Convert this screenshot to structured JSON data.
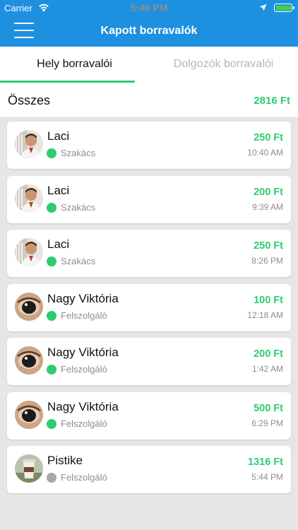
{
  "status_bar": {
    "carrier": "Carrier",
    "time": "5:49 PM"
  },
  "nav": {
    "title": "Kapott borravalók"
  },
  "tabs": [
    {
      "label": "Hely borravalói",
      "active": true
    },
    {
      "label": "Dolgozók borravalói",
      "active": false
    }
  ],
  "summary": {
    "label": "Összes",
    "total": "2816 Ft"
  },
  "colors": {
    "accent_blue": "#1e90e0",
    "accent_green": "#2ecc71",
    "status_active": "#2ecc71",
    "status_inactive": "#a7a7a7"
  },
  "tips": [
    {
      "name": "Laci",
      "role": "Szakács",
      "amount": "250 Ft",
      "time": "10:40 AM",
      "status_color": "#2ecc71",
      "avatar": "chef-avatar"
    },
    {
      "name": "Laci",
      "role": "Szakács",
      "amount": "200 Ft",
      "time": "9:39 AM",
      "status_color": "#2ecc71",
      "avatar": "chef-avatar"
    },
    {
      "name": "Laci",
      "role": "Szakács",
      "amount": "250 Ft",
      "time": "8:26 PM",
      "status_color": "#2ecc71",
      "avatar": "chef-avatar"
    },
    {
      "name": "Nagy Viktória",
      "role": "Felszolgáló",
      "amount": "100 Ft",
      "time": "12:18 AM",
      "status_color": "#2ecc71",
      "avatar": "eye-avatar"
    },
    {
      "name": "Nagy Viktória",
      "role": "Felszolgáló",
      "amount": "200 Ft",
      "time": "1:42 AM",
      "status_color": "#2ecc71",
      "avatar": "eye-avatar"
    },
    {
      "name": "Nagy Viktória",
      "role": "Felszolgáló",
      "amount": "500 Ft",
      "time": "6:29 PM",
      "status_color": "#2ecc71",
      "avatar": "eye-avatar"
    },
    {
      "name": "Pistike",
      "role": "Felszolgáló",
      "amount": "1316 Ft",
      "time": "5:44 PM",
      "status_color": "#a7a7a7",
      "avatar": "cup-avatar"
    }
  ]
}
